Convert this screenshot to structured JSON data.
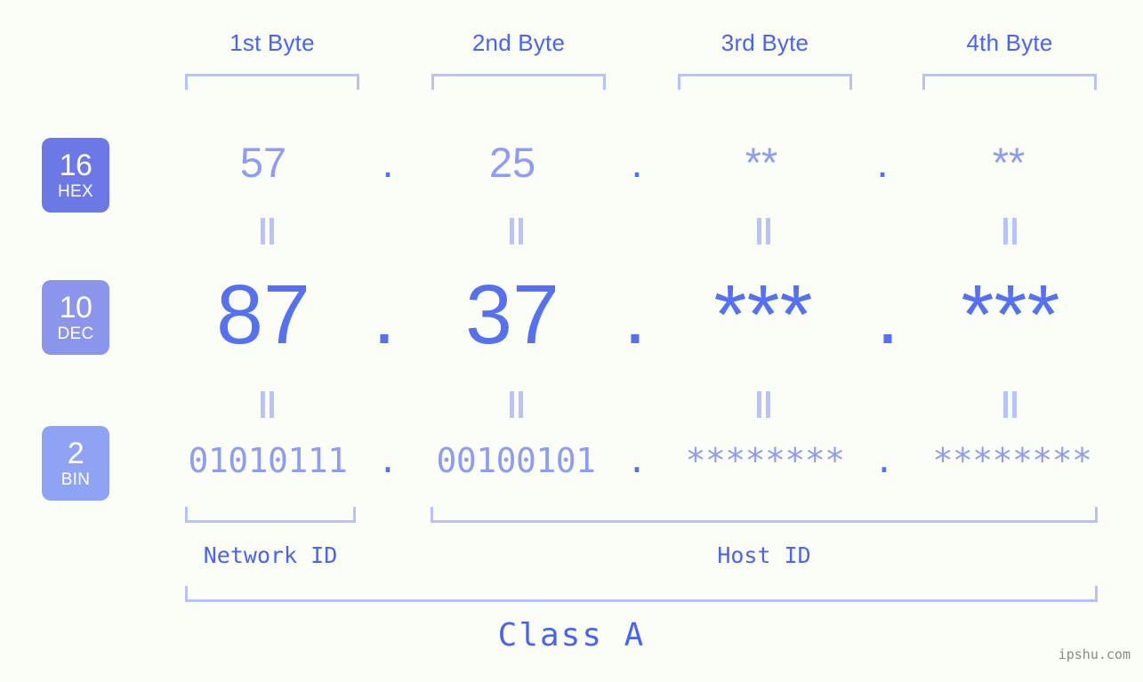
{
  "theme": {
    "background": "#fbfdf7",
    "accent_strong": "#4a64ef",
    "accent_value": "#5570f0",
    "accent_light": "#8f9cf4",
    "bracket": "#b7c2fb",
    "badge_hex": "#6c78e6",
    "badge_dec": "#8b95ec",
    "badge_bin": "#8fa3f5",
    "watermark_color": "#8a8a8a"
  },
  "headers": [
    {
      "label": "1st Byte"
    },
    {
      "label": "2nd Byte"
    },
    {
      "label": "3rd Byte"
    },
    {
      "label": "4th Byte"
    }
  ],
  "rows": [
    {
      "badge_number": "16",
      "badge_label": "HEX",
      "values": [
        "57",
        "25",
        "**",
        "**"
      ],
      "separator": "."
    },
    {
      "badge_number": "10",
      "badge_label": "DEC",
      "values": [
        "87",
        "37",
        "***",
        "***"
      ],
      "separator": "."
    },
    {
      "badge_number": "2",
      "badge_label": "BIN",
      "values": [
        "01010111",
        "00100101",
        "********",
        "********"
      ],
      "separator": "."
    }
  ],
  "segments": {
    "network_id": "Network ID",
    "host_id": "Host ID"
  },
  "class_label": "Class A",
  "watermark": "ipshu.com"
}
